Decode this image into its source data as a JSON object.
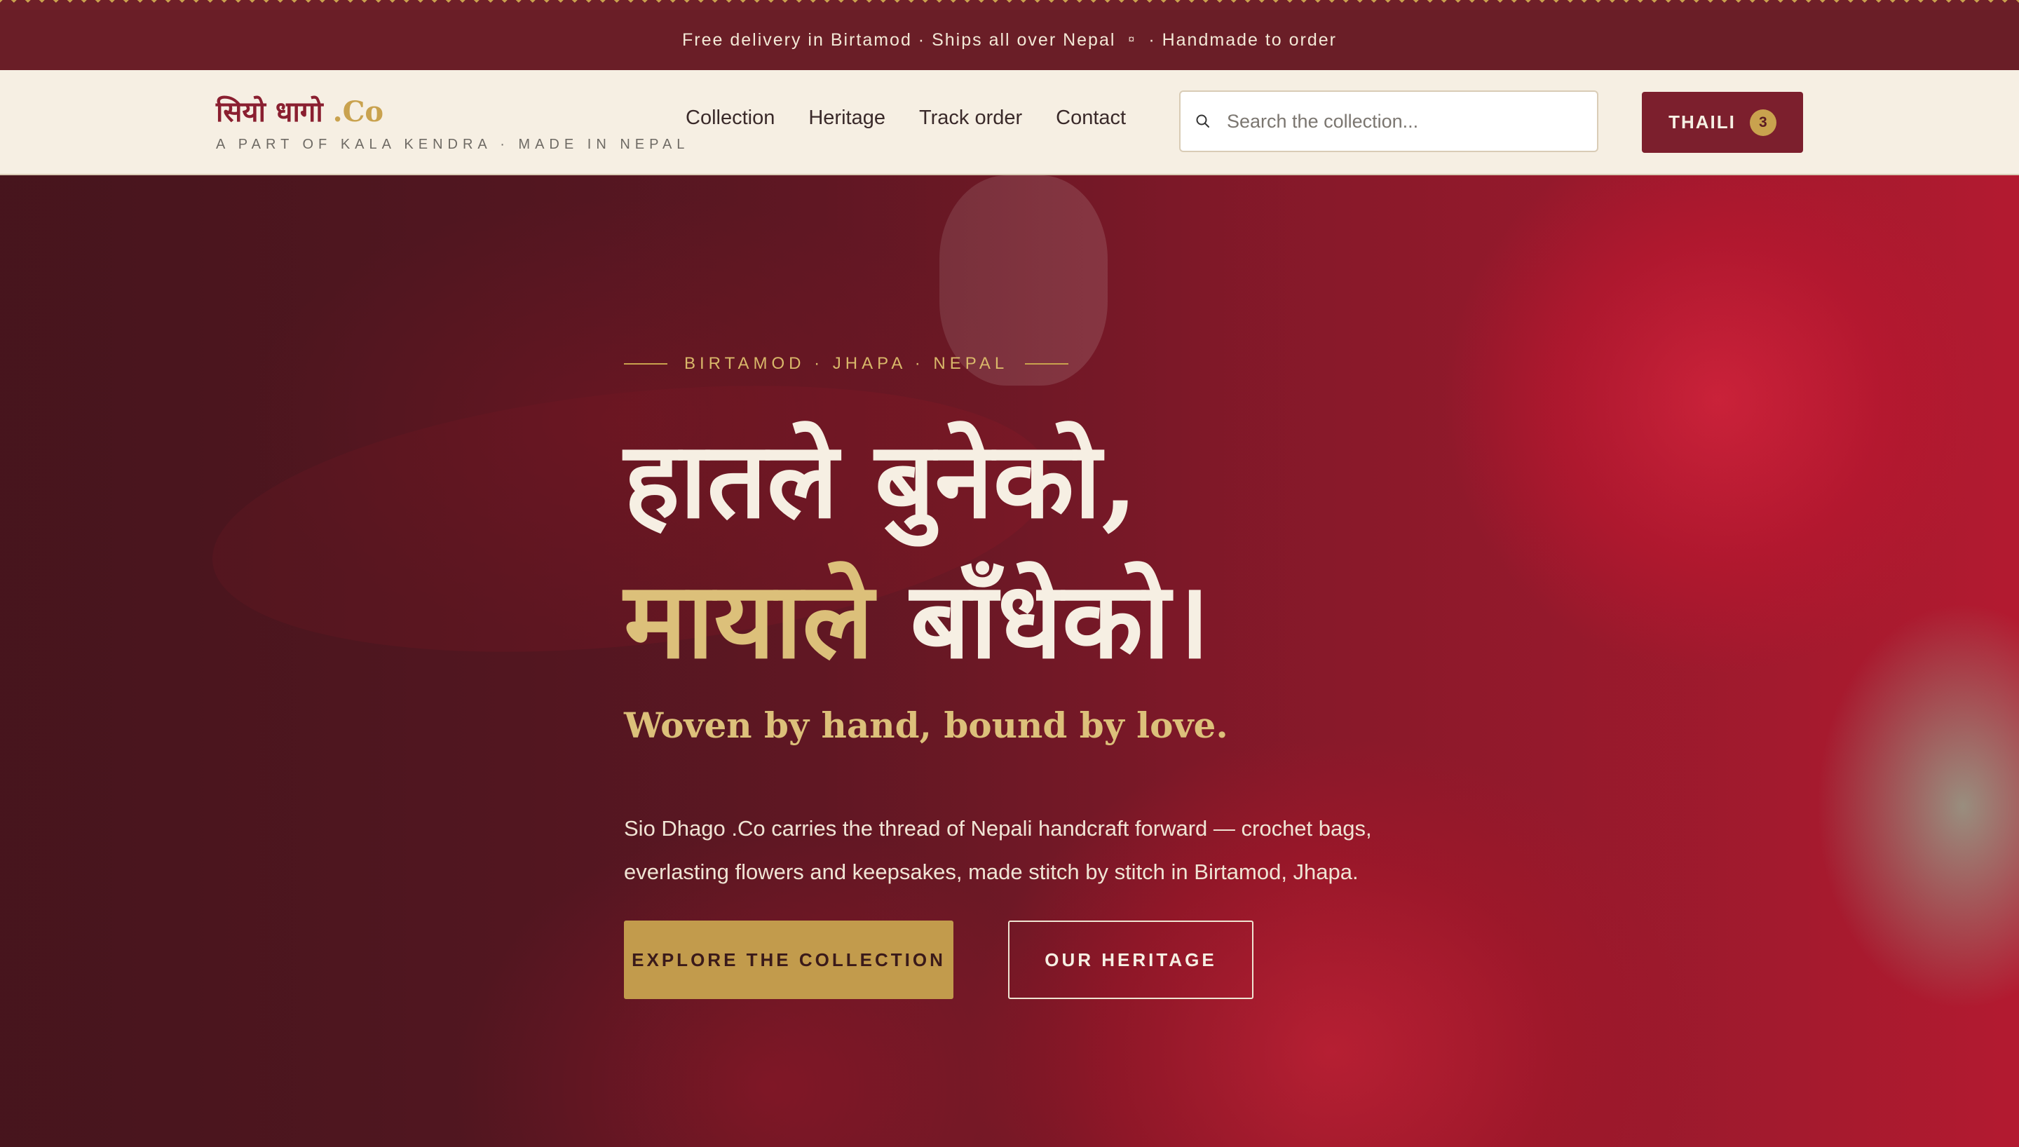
{
  "announcement": {
    "part1": "Free delivery in Birtamod · Ships all over Nepal",
    "separator": "¤",
    "part2": "· Handmade to order"
  },
  "brand": {
    "name_devanagari": "सियो धागो",
    "name_suffix": " .Co",
    "tagline": "A PART OF KALA KENDRA · MADE IN NEPAL"
  },
  "nav": {
    "links": [
      "Collection",
      "Heritage",
      "Track order",
      "Contact"
    ]
  },
  "search": {
    "placeholder": "Search the collection..."
  },
  "cart": {
    "label": "THAILI",
    "count": "3"
  },
  "hero": {
    "eyebrow": "BIRTAMOD · JHAPA · NEPAL",
    "headline_line1": "हातले बुनेको,",
    "headline_line2_gold": "मायाले",
    "headline_line2_rest": " बाँधेको।",
    "subhead": "Woven by hand, bound by love.",
    "description": "Sio Dhago .Co carries the thread of Nepali handcraft forward — crochet bags, everlasting flowers and keepsakes, made stitch by stitch in Birtamod, Jhapa.",
    "primary_cta": "EXPLORE THE COLLECTION",
    "secondary_cta": "OUR HERITAGE"
  },
  "colors": {
    "maroon": "#7c1f2d",
    "gold": "#c9a24e",
    "cream": "#f6efe3"
  },
  "icons": {
    "search": "search-icon"
  }
}
